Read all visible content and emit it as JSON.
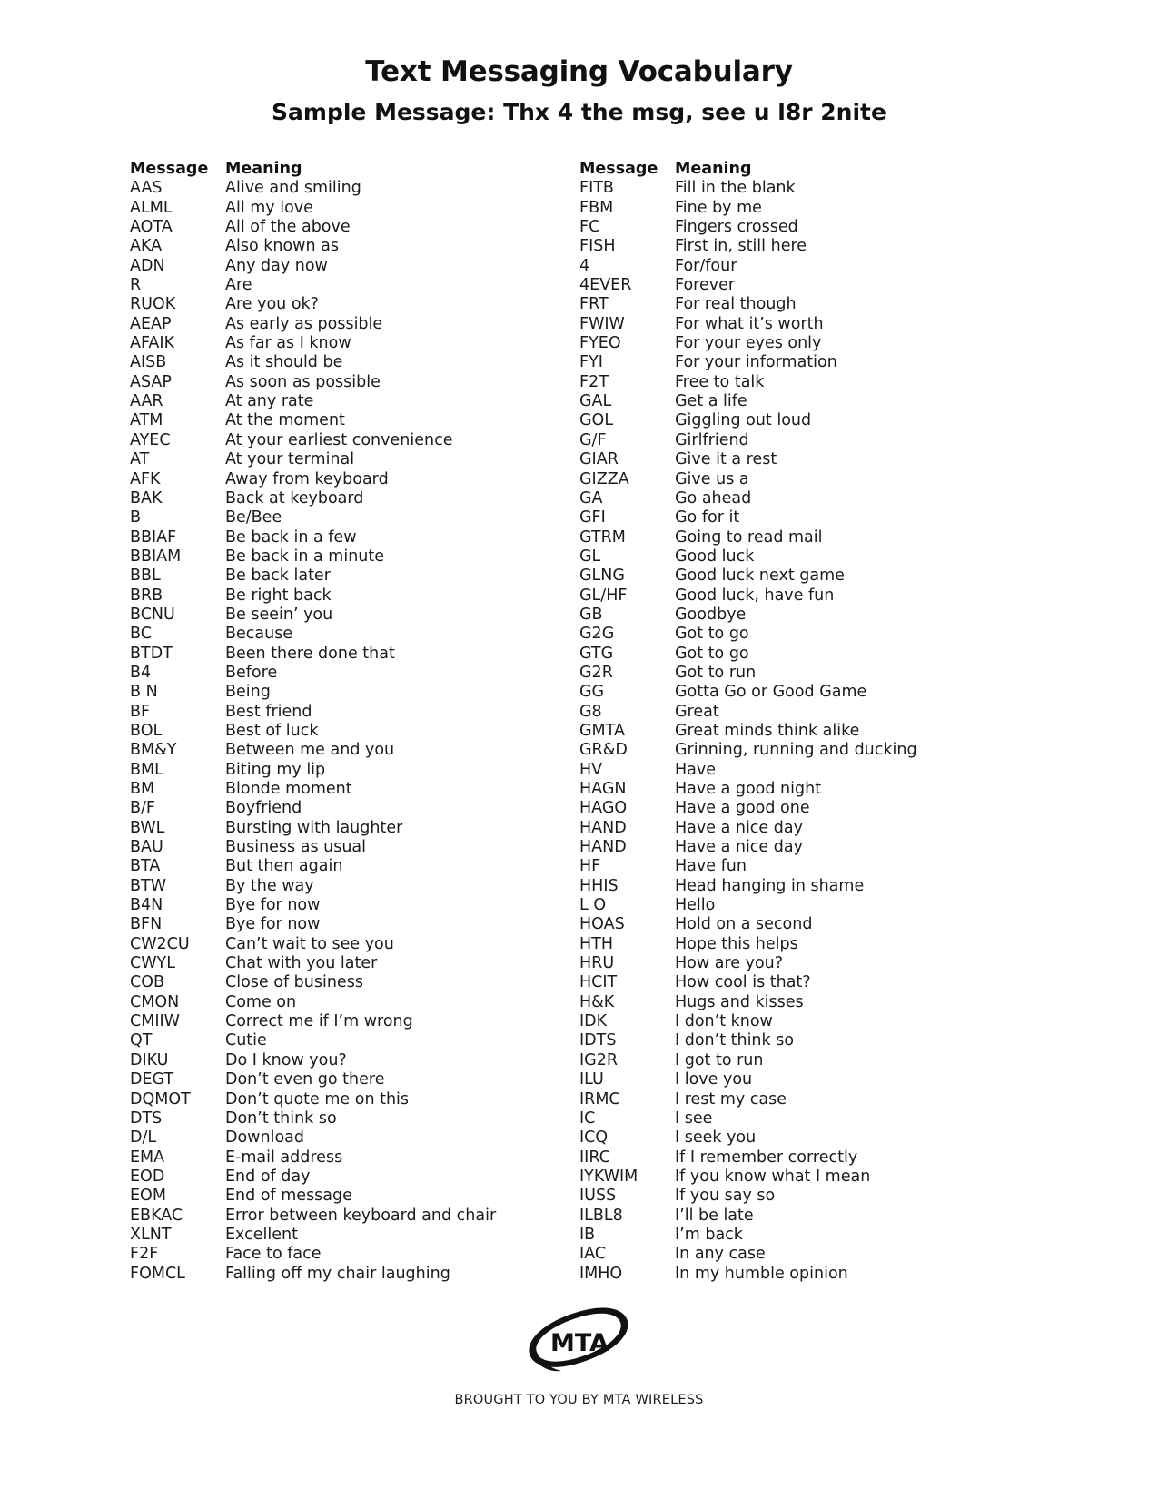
{
  "document": {
    "title": "Text Messaging Vocabulary",
    "subtitle": "Sample Message: Thx 4 the msg, see u l8r 2nite"
  },
  "table": {
    "headers": {
      "message": "Message",
      "meaning": "Meaning"
    },
    "left_column": [
      {
        "message": "AAS",
        "meaning": "Alive and smiling"
      },
      {
        "message": "ALML",
        "meaning": "All my love"
      },
      {
        "message": "AOTA",
        "meaning": "All of the above"
      },
      {
        "message": "AKA",
        "meaning": "Also known as"
      },
      {
        "message": "ADN",
        "meaning": "Any day now"
      },
      {
        "message": "R",
        "meaning": "Are"
      },
      {
        "message": "RUOK",
        "meaning": "Are you ok?"
      },
      {
        "message": "AEAP",
        "meaning": "As early as possible"
      },
      {
        "message": "AFAIK",
        "meaning": "As far as I know"
      },
      {
        "message": "AISB",
        "meaning": "As it should be"
      },
      {
        "message": "ASAP",
        "meaning": "As soon as possible"
      },
      {
        "message": "AAR",
        "meaning": "At any rate"
      },
      {
        "message": "ATM",
        "meaning": "At the moment"
      },
      {
        "message": "AYEC",
        "meaning": "At your earliest convenience"
      },
      {
        "message": "AT",
        "meaning": "At your terminal"
      },
      {
        "message": "AFK",
        "meaning": "Away from keyboard"
      },
      {
        "message": "BAK",
        "meaning": "Back at keyboard"
      },
      {
        "message": "B",
        "meaning": "Be/Bee"
      },
      {
        "message": "BBIAF",
        "meaning": "Be back in a few"
      },
      {
        "message": "BBIAM",
        "meaning": "Be back in a minute"
      },
      {
        "message": "BBL",
        "meaning": "Be back later"
      },
      {
        "message": "BRB",
        "meaning": "Be right back"
      },
      {
        "message": "BCNU",
        "meaning": "Be seein’ you"
      },
      {
        "message": "BC",
        "meaning": "Because"
      },
      {
        "message": "BTDT",
        "meaning": "Been there done that"
      },
      {
        "message": "B4",
        "meaning": "Before"
      },
      {
        "message": "B N",
        "meaning": "Being"
      },
      {
        "message": "BF",
        "meaning": "Best friend"
      },
      {
        "message": "BOL",
        "meaning": "Best of luck"
      },
      {
        "message": "BM&Y",
        "meaning": "Between me and you"
      },
      {
        "message": "BML",
        "meaning": "Biting my lip"
      },
      {
        "message": "BM",
        "meaning": "Blonde moment"
      },
      {
        "message": "B/F",
        "meaning": "Boyfriend"
      },
      {
        "message": "BWL",
        "meaning": "Bursting with laughter"
      },
      {
        "message": "BAU",
        "meaning": "Business as usual"
      },
      {
        "message": "BTA",
        "meaning": "But then again"
      },
      {
        "message": "BTW",
        "meaning": "By the way"
      },
      {
        "message": "B4N",
        "meaning": "Bye for now"
      },
      {
        "message": "BFN",
        "meaning": "Bye for now"
      },
      {
        "message": "CW2CU",
        "meaning": "Can’t wait to see you"
      },
      {
        "message": "CWYL",
        "meaning": "Chat with you later"
      },
      {
        "message": "COB",
        "meaning": "Close of business"
      },
      {
        "message": "CMON",
        "meaning": "Come on"
      },
      {
        "message": "CMIIW",
        "meaning": "Correct me if I’m wrong"
      },
      {
        "message": "QT",
        "meaning": "Cutie"
      },
      {
        "message": "DIKU",
        "meaning": "Do I know you?"
      },
      {
        "message": "DEGT",
        "meaning": "Don’t even go there"
      },
      {
        "message": "DQMOT",
        "meaning": "Don’t quote me on this"
      },
      {
        "message": "DTS",
        "meaning": "Don’t think so"
      },
      {
        "message": "D/L",
        "meaning": "Download"
      },
      {
        "message": "EMA",
        "meaning": "E-mail address"
      },
      {
        "message": "EOD",
        "meaning": "End of day"
      },
      {
        "message": "EOM",
        "meaning": "End of message"
      },
      {
        "message": "EBKAC",
        "meaning": "Error between keyboard and chair"
      },
      {
        "message": "XLNT",
        "meaning": "Excellent"
      },
      {
        "message": "F2F",
        "meaning": "Face to face"
      },
      {
        "message": "FOMCL",
        "meaning": "Falling off my chair laughing"
      }
    ],
    "right_column": [
      {
        "message": "FITB",
        "meaning": "Fill in the blank"
      },
      {
        "message": "FBM",
        "meaning": "Fine by me"
      },
      {
        "message": "FC",
        "meaning": "Fingers crossed"
      },
      {
        "message": "FISH",
        "meaning": "First in, still here"
      },
      {
        "message": "4",
        "meaning": "For/four"
      },
      {
        "message": "4EVER",
        "meaning": "Forever"
      },
      {
        "message": "FRT",
        "meaning": "For real though"
      },
      {
        "message": "FWIW",
        "meaning": "For what it’s worth"
      },
      {
        "message": "FYEO",
        "meaning": "For your eyes only"
      },
      {
        "message": "FYI",
        "meaning": "For your information"
      },
      {
        "message": "F2T",
        "meaning": "Free to talk"
      },
      {
        "message": "GAL",
        "meaning": "Get a life"
      },
      {
        "message": "GOL",
        "meaning": "Giggling out loud"
      },
      {
        "message": "G/F",
        "meaning": "Girlfriend"
      },
      {
        "message": "GIAR",
        "meaning": "Give it a rest"
      },
      {
        "message": "GIZZA",
        "meaning": "Give us a"
      },
      {
        "message": "GA",
        "meaning": "Go ahead"
      },
      {
        "message": "GFI",
        "meaning": "Go for it"
      },
      {
        "message": "GTRM",
        "meaning": "Going to read mail"
      },
      {
        "message": "GL",
        "meaning": "Good luck"
      },
      {
        "message": "GLNG",
        "meaning": "Good luck next game"
      },
      {
        "message": "GL/HF",
        "meaning": "Good luck, have fun"
      },
      {
        "message": "GB",
        "meaning": "Goodbye"
      },
      {
        "message": "G2G",
        "meaning": "Got to go"
      },
      {
        "message": "GTG",
        "meaning": "Got to go"
      },
      {
        "message": "G2R",
        "meaning": "Got to run"
      },
      {
        "message": "GG",
        "meaning": "Gotta Go or Good Game"
      },
      {
        "message": "G8",
        "meaning": "Great"
      },
      {
        "message": "GMTA",
        "meaning": "Great minds think alike"
      },
      {
        "message": "GR&D",
        "meaning": "Grinning, running and ducking"
      },
      {
        "message": "HV",
        "meaning": "Have"
      },
      {
        "message": "HAGN",
        "meaning": "Have a good night"
      },
      {
        "message": "HAGO",
        "meaning": "Have a good one"
      },
      {
        "message": "HAND",
        "meaning": "Have a nice day"
      },
      {
        "message": "HAND",
        "meaning": "Have a nice day"
      },
      {
        "message": "HF",
        "meaning": "Have fun"
      },
      {
        "message": "HHIS",
        "meaning": "Head hanging in shame"
      },
      {
        "message": "L O",
        "meaning": "Hello"
      },
      {
        "message": "HOAS",
        "meaning": "Hold on a second"
      },
      {
        "message": "HTH",
        "meaning": "Hope this helps"
      },
      {
        "message": "HRU",
        "meaning": "How are you?"
      },
      {
        "message": "HCIT",
        "meaning": "How cool is that?"
      },
      {
        "message": "H&K",
        "meaning": "Hugs and kisses"
      },
      {
        "message": "IDK",
        "meaning": "I don’t know"
      },
      {
        "message": "IDTS",
        "meaning": "I don’t think so"
      },
      {
        "message": "IG2R",
        "meaning": "I got to run"
      },
      {
        "message": "ILU",
        "meaning": "I love you"
      },
      {
        "message": "IRMC",
        "meaning": "I rest my case"
      },
      {
        "message": "IC",
        "meaning": "I see"
      },
      {
        "message": "ICQ",
        "meaning": "I seek you"
      },
      {
        "message": "IIRC",
        "meaning": "If I remember correctly"
      },
      {
        "message": "IYKWIM",
        "meaning": "If you know what I mean"
      },
      {
        "message": "IUSS",
        "meaning": "If you say so"
      },
      {
        "message": "ILBL8",
        "meaning": "I’ll be late"
      },
      {
        "message": "IB",
        "meaning": "I’m back"
      },
      {
        "message": "IAC",
        "meaning": "In any case"
      },
      {
        "message": "IMHO",
        "meaning": "In my humble opinion"
      }
    ]
  },
  "footer": {
    "logo_text": "MTA",
    "tagline": "BROUGHT TO YOU BY MTA WIRELESS"
  }
}
